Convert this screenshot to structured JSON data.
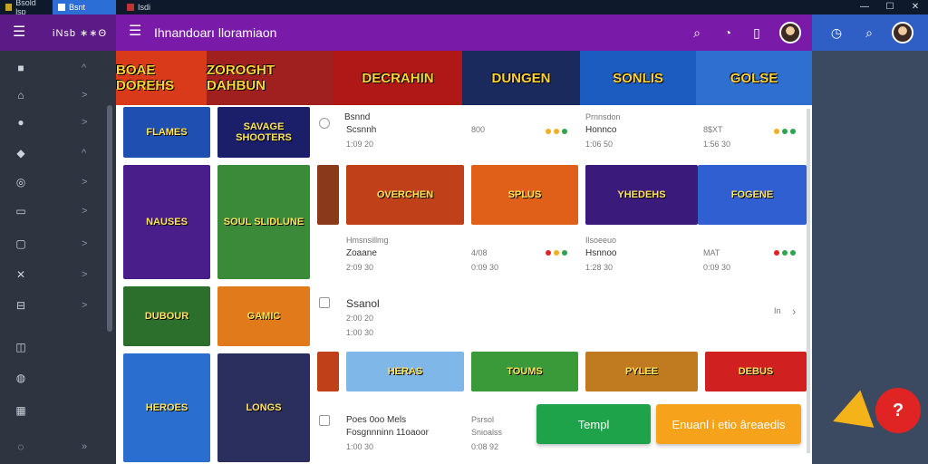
{
  "os": {
    "tabs": [
      {
        "label": "Bsold lsp"
      },
      {
        "label": "Bsnt"
      },
      {
        "label": "Isdi"
      }
    ],
    "controls": [
      "—",
      "☐",
      "✕"
    ]
  },
  "left_header": {
    "brand": "iNsb ∗∗Θ"
  },
  "main_header": {
    "title": "Ihnandoarı lloramiaon"
  },
  "sidebar": {
    "items": [
      {
        "icon": "square-icon",
        "glyph": "■",
        "chev": "^"
      },
      {
        "icon": "home-icon",
        "glyph": "⌂",
        "chev": ">"
      },
      {
        "icon": "info-icon",
        "glyph": "●",
        "chev": ">"
      },
      {
        "icon": "tag-icon",
        "glyph": "◆",
        "chev": "^"
      },
      {
        "icon": "target-icon",
        "glyph": "◎",
        "chev": ">"
      },
      {
        "icon": "monitor-icon",
        "glyph": "▭",
        "chev": ">"
      },
      {
        "icon": "bag-icon",
        "glyph": "▢",
        "chev": ">"
      },
      {
        "icon": "cross-icon",
        "glyph": "✕",
        "chev": ">"
      },
      {
        "icon": "briefcase-icon",
        "glyph": "⊟",
        "chev": ">"
      },
      {
        "icon": "book-icon",
        "glyph": "◫",
        "chev": ""
      },
      {
        "icon": "globe-icon",
        "glyph": "◍",
        "chev": ""
      },
      {
        "icon": "grid-icon",
        "glyph": "▦",
        "chev": ""
      },
      {
        "icon": "settings-icon",
        "glyph": "◌",
        "chev": "»"
      }
    ]
  },
  "banner": {
    "slots": [
      {
        "label": "BOAE DOREHS",
        "bg": "#d93a1a"
      },
      {
        "label": "ZOROGHT DAHBUN",
        "bg": "#a02020"
      },
      {
        "label": "DECRAHIN",
        "bg": "#b01818"
      },
      {
        "label": "DUNGEN",
        "bg": "#1a2a5c"
      },
      {
        "label": "SONLIS",
        "bg": "#1c5cc0"
      },
      {
        "label": "GOLSE",
        "bg": "#2f6fd0"
      }
    ]
  },
  "rows": {
    "row1": {
      "title": "Bsnnd",
      "sub": "Scsnnh",
      "date": "1:09 20",
      "mid_val": "800",
      "mid_dots": "●●●",
      "mid_sub": "Prnnsdon",
      "mid_sub2": "Honnco",
      "mid_date": "1:06 50",
      "right_val": "8$XT",
      "right_sub": "1:56 30"
    },
    "row2": {
      "small": "Hmsnsillmg",
      "title": "Zoaane",
      "date": "2:09 30",
      "mid_val": "4/08",
      "mid_date": "0:09 30",
      "right_small": "Ilsoeeuo",
      "right_title": "Hsnnoo",
      "right_date": "1:28 30",
      "far_val": "MAT",
      "far_date": "0:09 30"
    },
    "row3": {
      "title": "Ssanol",
      "sub": "2:00 20",
      "date": "1:00 30",
      "badge": "In"
    },
    "row4": {
      "title": "Poes 0oo Mels",
      "sub": "Fosgnnninn 11oaoor",
      "date": "1:00 30",
      "mid_small": "Psrsol",
      "mid_title": "Snioalss",
      "mid_date": "0:08 92"
    }
  },
  "thumbs": {
    "left1": {
      "label": "FLAMES",
      "bg": "#1f4fb0"
    },
    "left2": {
      "label": "SAVAGE SHOOTERS",
      "bg": "#1b1f6a"
    },
    "left3": {
      "label": "NAUSES",
      "bg": "#4a1e8a"
    },
    "left4": {
      "label": "SOUL SLIDLUNE",
      "bg": "#3a8a3a"
    },
    "left5": {
      "label": "DUBOUR",
      "bg": "#2c6f2c"
    },
    "left6": {
      "label": "GAMIC",
      "bg": "#e07a1a"
    },
    "left7": {
      "label": "HEROES",
      "bg": "#2a6fd0"
    },
    "left8": {
      "label": "LONGS",
      "bg": "#2b2f5e"
    },
    "mid1": {
      "label": "OVERCHEN",
      "bg": "#c0401a"
    },
    "mid2": {
      "label": "SPLUS",
      "bg": "#e0601a"
    },
    "mid3": {
      "label": "YHEDEHS",
      "bg": "#3a1a7a"
    },
    "mid4": {
      "label": "FOGENE",
      "bg": "#2f5fd0"
    },
    "mid5": {
      "label": "HERAS",
      "bg": "#7fb8e8"
    },
    "mid6": {
      "label": "TOUMS",
      "bg": "#3a9a3a"
    },
    "mid7": {
      "label": "PYLEE",
      "bg": "#c07a20"
    },
    "mid8": {
      "label": "DEBUS",
      "bg": "#d02020"
    }
  },
  "actions": {
    "primary": "Templ",
    "secondary": "Enuanl i etio âreaedis"
  },
  "help": {
    "glyph": "?"
  }
}
